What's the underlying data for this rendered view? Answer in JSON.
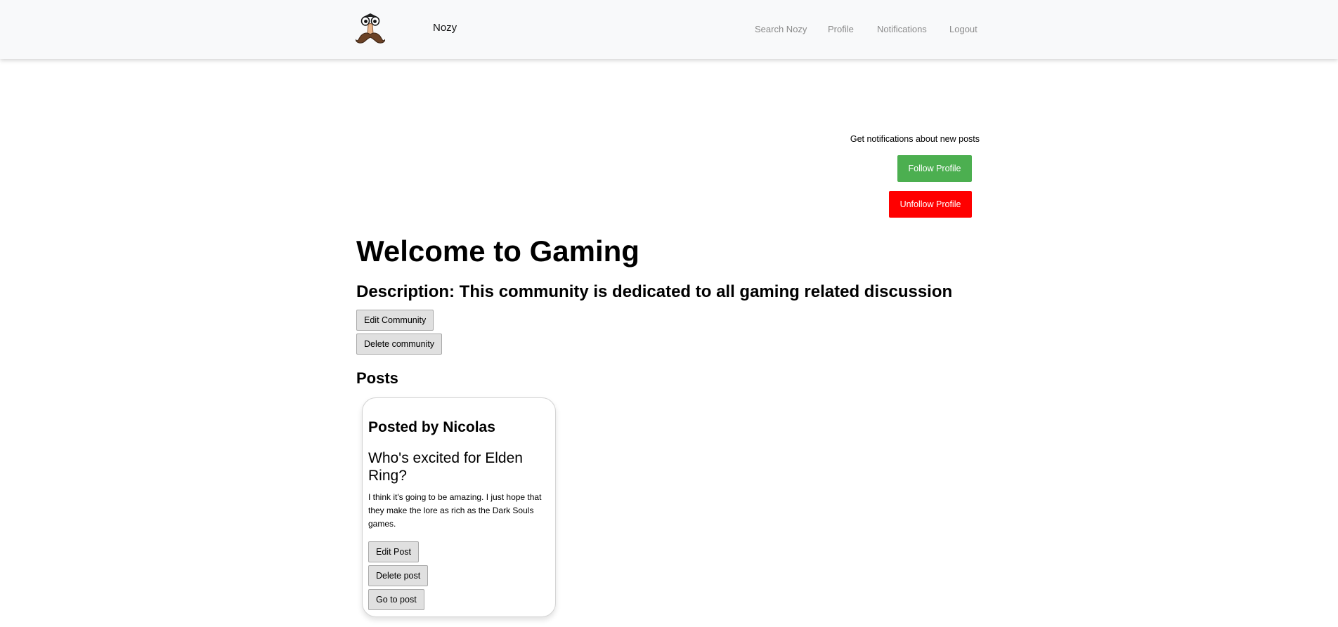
{
  "navbar": {
    "logo_icon": "mustache-face-logo-icon",
    "brand": "Nozy",
    "links": [
      "Search Nozy",
      "Profile",
      "Notifications",
      "Logout"
    ]
  },
  "follow": {
    "prompt": "Get notifications about new posts",
    "follow_label": "Follow Profile",
    "unfollow_label": "Unfollow Profile",
    "follow_color": "#4caf50",
    "unfollow_color": "#ff0000"
  },
  "community": {
    "title": "Welcome to Gaming",
    "description": "Description: This community is dedicated to all gaming related discussion",
    "edit_label": "Edit Community",
    "delete_label": "Delete community"
  },
  "posts": {
    "heading": "Posts",
    "items": [
      {
        "author_line": "Posted by Nicolas",
        "title": "Who's excited for Elden Ring?",
        "body": "I think it's going to be amazing. I just hope that they make the lore as rich as the Dark Souls games.",
        "edit_label": "Edit Post",
        "delete_label": "Delete post",
        "go_label": "Go to post"
      }
    ]
  }
}
